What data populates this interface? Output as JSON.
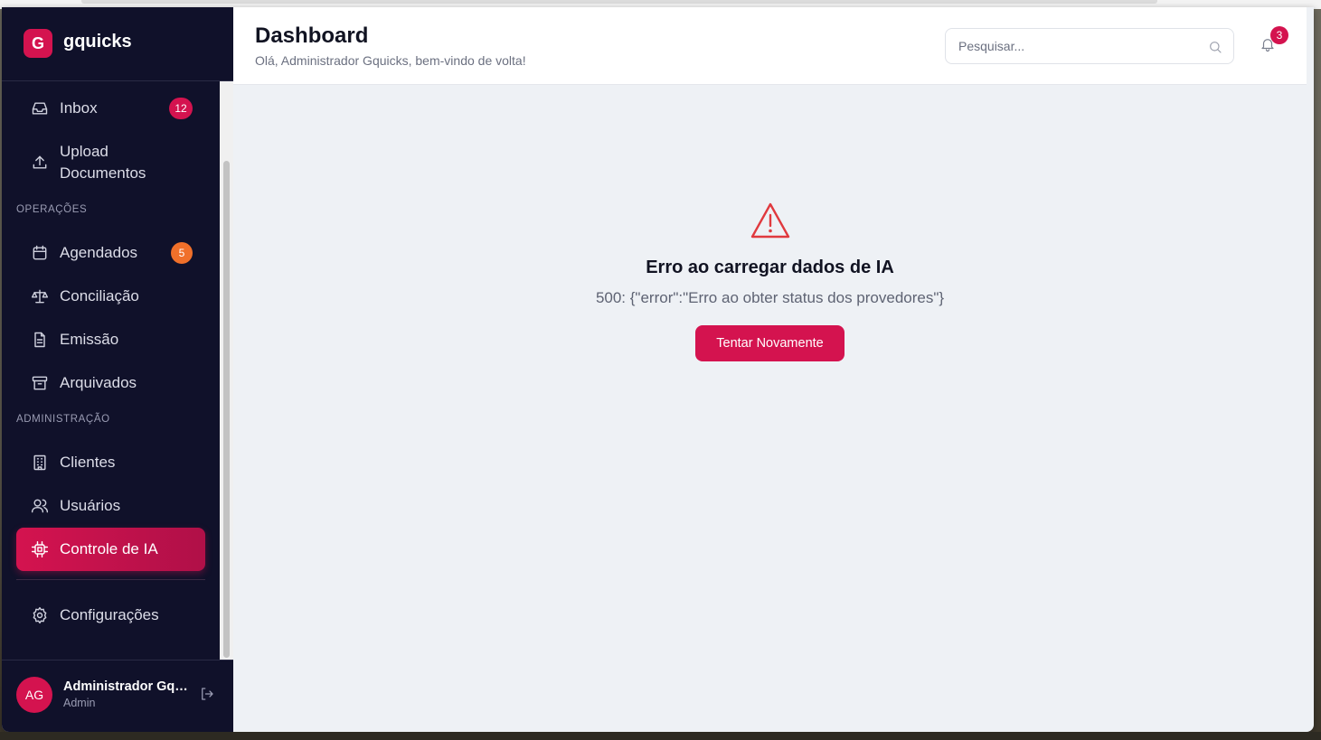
{
  "brand": {
    "logo_letter": "G",
    "name": "gquicks",
    "accent": "#d4134f"
  },
  "sidebar": {
    "top_items": [
      {
        "label": "Inbox",
        "icon": "inbox-icon",
        "badge": "12",
        "badge_color": "#d4134f"
      },
      {
        "label": "Upload Documentos",
        "icon": "upload-icon"
      }
    ],
    "sections": [
      {
        "title": "OPERAÇÕES",
        "items": [
          {
            "label": "Agendados",
            "icon": "calendar-icon",
            "badge": "5",
            "badge_color": "#f0702a"
          },
          {
            "label": "Conciliação",
            "icon": "scale-icon"
          },
          {
            "label": "Emissão",
            "icon": "file-text-icon"
          },
          {
            "label": "Arquivados",
            "icon": "archive-icon"
          }
        ]
      },
      {
        "title": "ADMINISTRAÇÃO",
        "items": [
          {
            "label": "Clientes",
            "icon": "building-icon"
          },
          {
            "label": "Usuários",
            "icon": "users-icon"
          },
          {
            "label": "Controle de IA",
            "icon": "cpu-icon",
            "active": true
          }
        ]
      }
    ],
    "settings": {
      "label": "Configurações",
      "icon": "gear-icon"
    },
    "user": {
      "initials": "AG",
      "name": "Administrador Gquicks",
      "role": "Admin"
    }
  },
  "header": {
    "title": "Dashboard",
    "subtitle": "Olá, Administrador Gquicks, bem-vindo de volta!",
    "search_placeholder": "Pesquisar...",
    "notifications": "3"
  },
  "main": {
    "error_title": "Erro ao carregar dados de IA",
    "error_message": "500: {\"error\":\"Erro ao obter status dos provedores\"}",
    "retry_label": "Tentar Novamente",
    "error_color": "#e0393e"
  }
}
